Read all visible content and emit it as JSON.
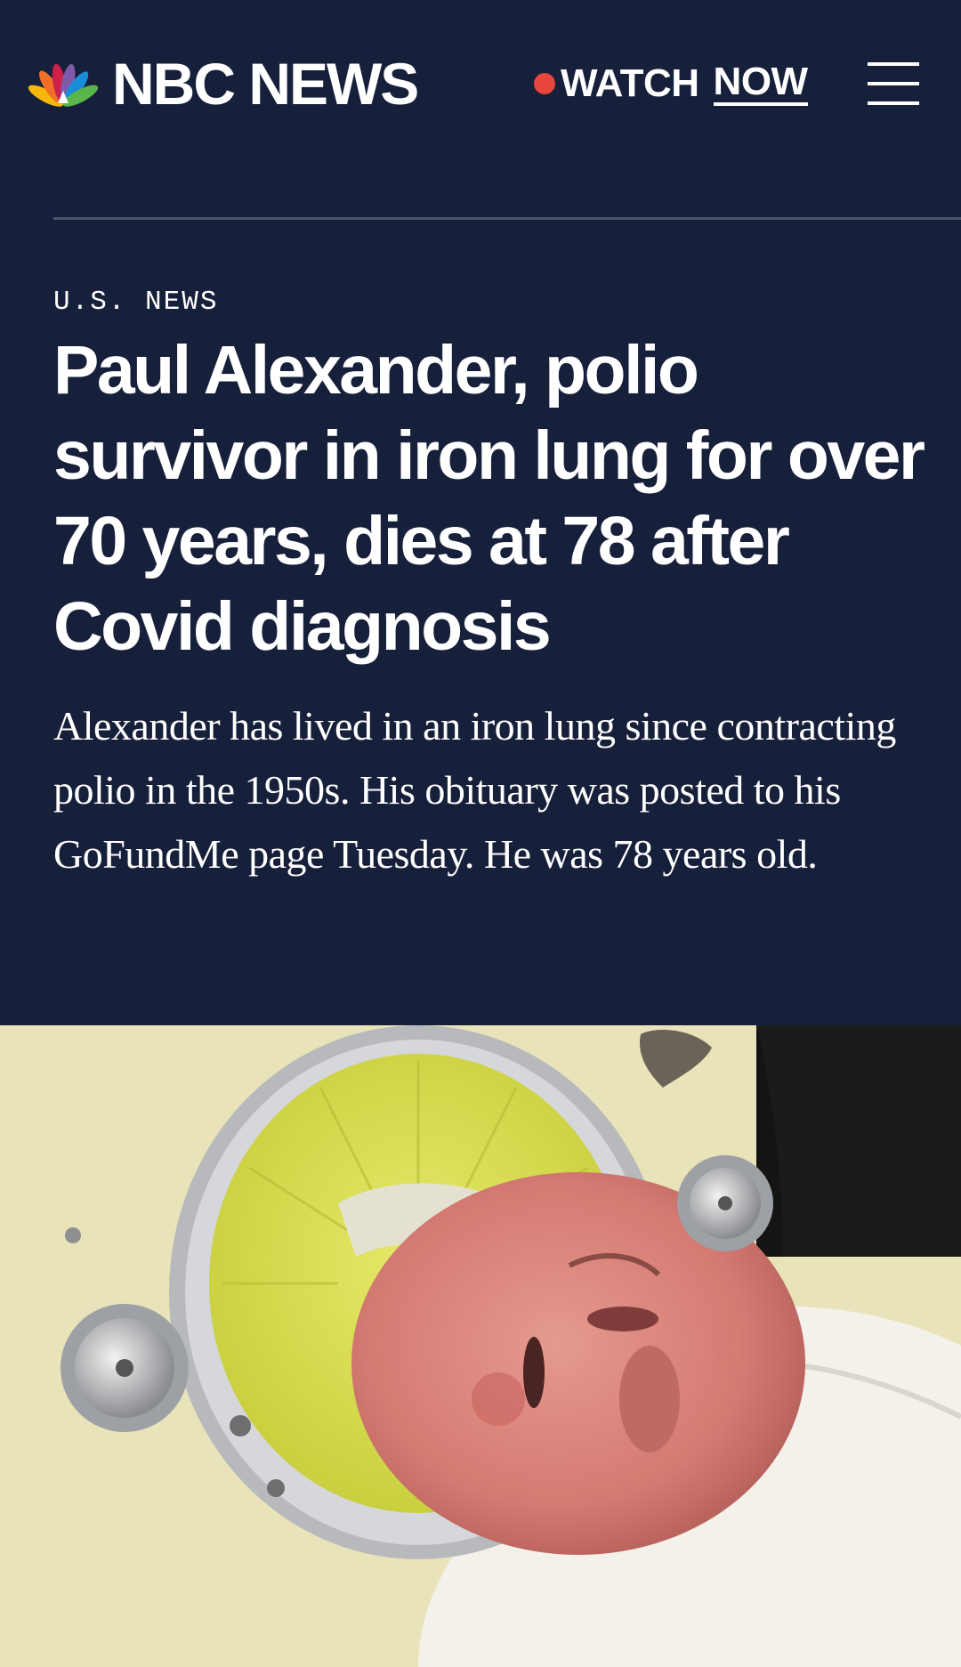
{
  "header": {
    "logo_text": "NBC NEWS",
    "watch_label": "WATCH",
    "now_label": "NOW",
    "live_dot_color": "#e8453c",
    "menu_icon": "hamburger-menu-icon",
    "logo_icon": "peacock-logo-icon"
  },
  "article": {
    "section": "U.S. NEWS",
    "headline": "Paul Alexander, polio survivor in iron lung for over 70 years, dies at 78 after Covid diagnosis",
    "dek": "Alexander has lived in an iron lung since contracting polio in the 1950s. His obituary was posted to his GoFundMe page Tuesday. He was 78 years old."
  },
  "colors": {
    "background": "#17203a",
    "divider": "#4b5368",
    "text": "#ffffff"
  }
}
